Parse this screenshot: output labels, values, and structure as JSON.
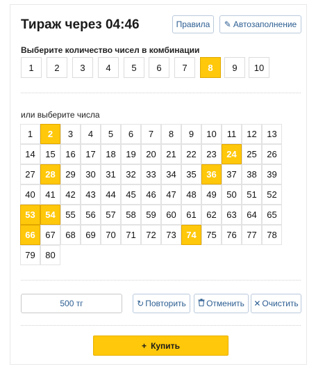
{
  "header": {
    "title": "Тираж через 04:46",
    "rules_label": "Правила",
    "autofill_label": "Автозаполнение",
    "autofill_icon": "pencil-icon"
  },
  "count_section": {
    "label": "Выберите количество чисел в комбинации",
    "options": [
      "1",
      "2",
      "3",
      "4",
      "5",
      "6",
      "7",
      "8",
      "9",
      "10"
    ],
    "selected": "8"
  },
  "numbers_section": {
    "label": "или выберите числа",
    "numbers": [
      "1",
      "2",
      "3",
      "4",
      "5",
      "6",
      "7",
      "8",
      "9",
      "10",
      "11",
      "12",
      "13",
      "14",
      "15",
      "16",
      "17",
      "18",
      "19",
      "20",
      "21",
      "22",
      "23",
      "24",
      "25",
      "26",
      "27",
      "28",
      "29",
      "30",
      "31",
      "32",
      "33",
      "34",
      "35",
      "36",
      "37",
      "38",
      "39",
      "40",
      "41",
      "42",
      "43",
      "44",
      "45",
      "46",
      "47",
      "48",
      "49",
      "50",
      "51",
      "52",
      "53",
      "54",
      "55",
      "56",
      "57",
      "58",
      "59",
      "60",
      "61",
      "62",
      "63",
      "64",
      "65",
      "66",
      "67",
      "68",
      "69",
      "70",
      "71",
      "72",
      "73",
      "74",
      "75",
      "76",
      "77",
      "78",
      "79",
      "80"
    ],
    "selected": [
      "2",
      "24",
      "28",
      "36",
      "53",
      "54",
      "66",
      "74"
    ]
  },
  "actions": {
    "price": "500 тг",
    "repeat_label": "Повторить",
    "cancel_label": "Отменить",
    "clear_label": "Очистить"
  },
  "buy": {
    "label": "Купить",
    "icon_glyph": "+"
  },
  "colors": {
    "accent": "#ffc80a",
    "link": "#2b5d91"
  }
}
